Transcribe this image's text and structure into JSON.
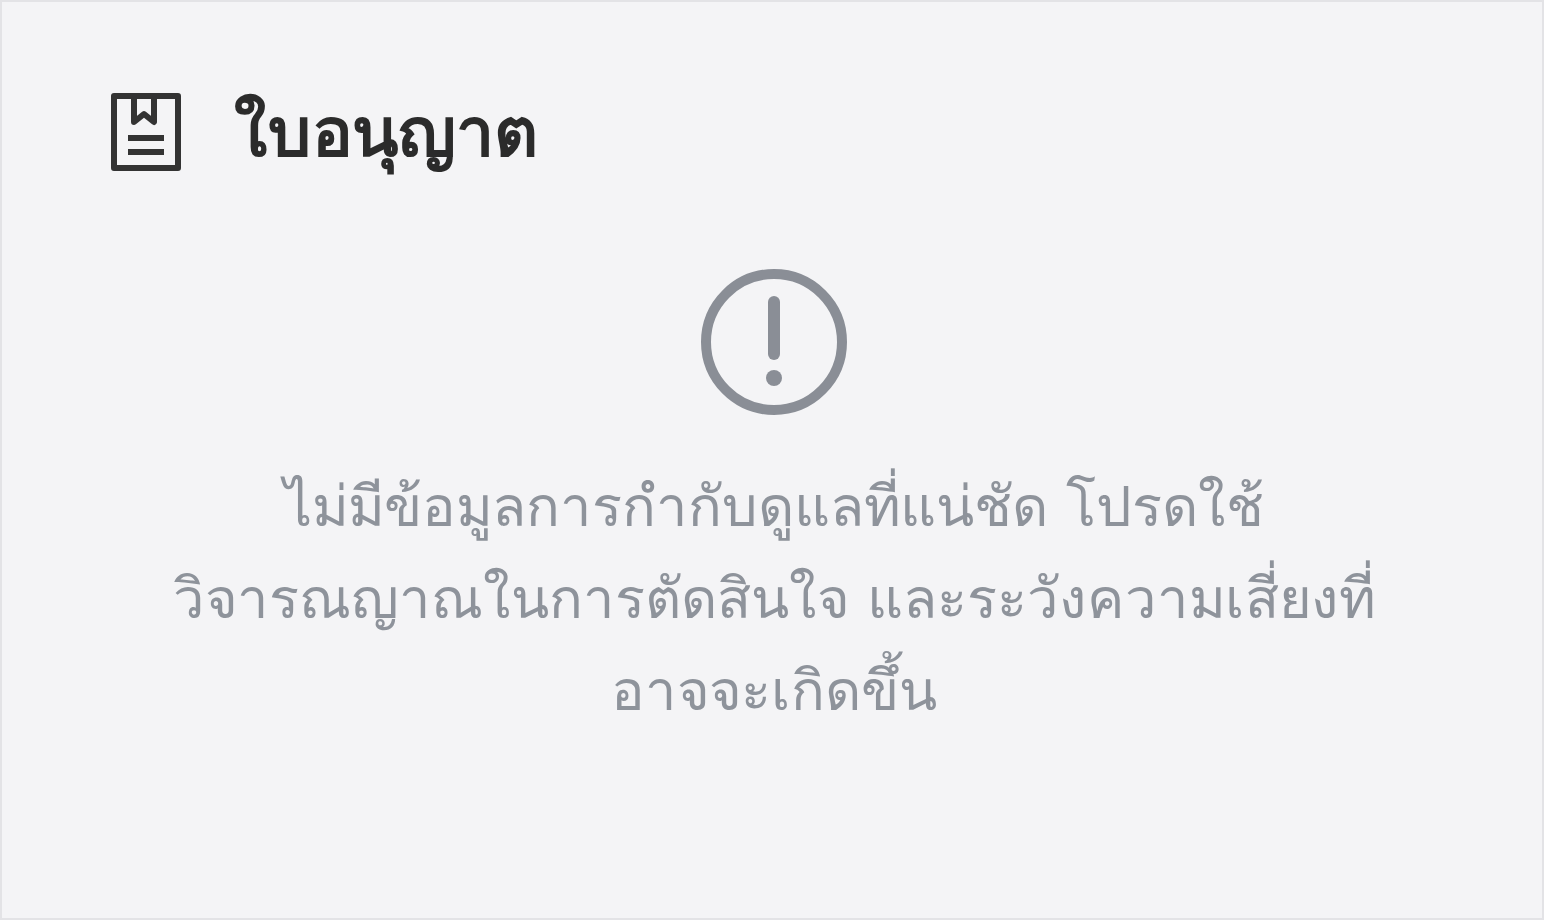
{
  "card": {
    "title": "ใบอนุญาต",
    "message": "ไม่มีข้อมูลการกำกับดูแลที่แน่ชัด โปรดใช้วิจารณญาณในการตัดสินใจ และระวังความเสี่ยงที่อาจจะเกิดขึ้น"
  }
}
